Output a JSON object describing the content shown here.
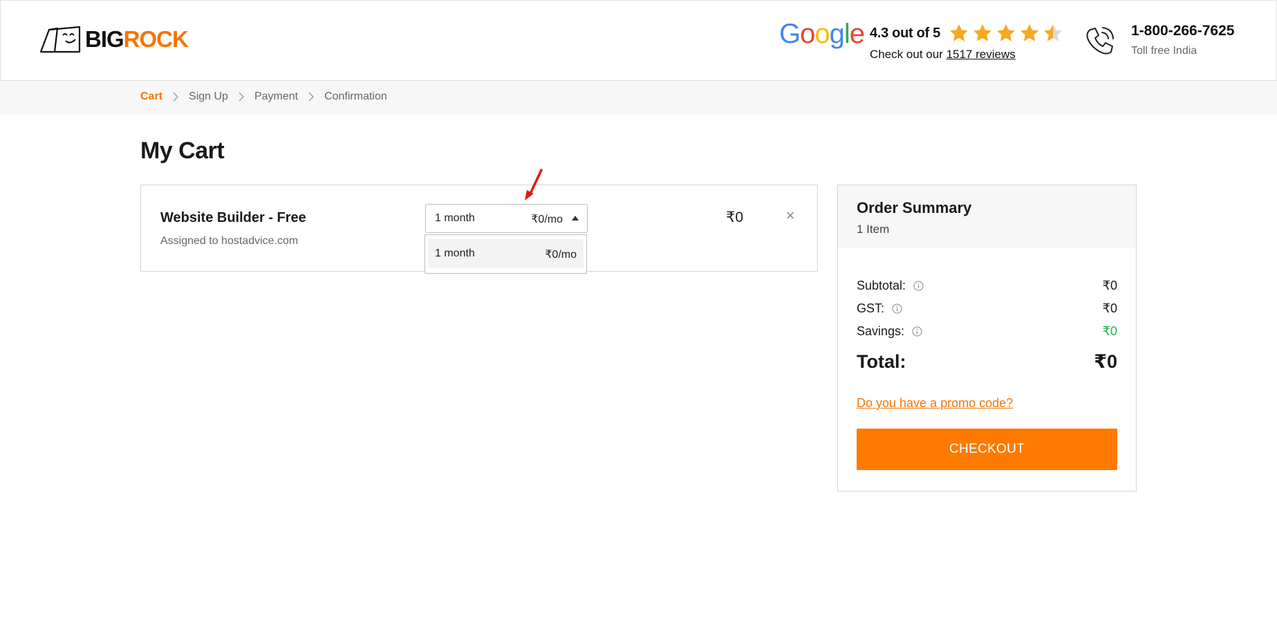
{
  "header": {
    "logo_big": "BIG",
    "logo_rock": "ROCK",
    "google_letters": [
      "G",
      "o",
      "o",
      "g",
      "l",
      "e"
    ],
    "rating_text": "4.3 out of 5",
    "stars": 4.5,
    "reviews_prefix": "Check out our ",
    "reviews_link": "1517 reviews",
    "phone_number": "1-800-266-7625",
    "phone_sub": "Toll free India"
  },
  "breadcrumb": {
    "items": [
      {
        "label": "Cart",
        "active": true
      },
      {
        "label": "Sign Up",
        "active": false
      },
      {
        "label": "Payment",
        "active": false
      },
      {
        "label": "Confirmation",
        "active": false
      }
    ]
  },
  "page_title": "My Cart",
  "cart_item": {
    "name": "Website Builder - Free",
    "assigned": "Assigned to hostadvice.com",
    "select_term": "1 month",
    "select_price": "₹0/mo",
    "price": "₹0",
    "remove_symbol": "×",
    "dropdown_options": [
      {
        "term": "1 month",
        "price": "₹0/mo"
      }
    ]
  },
  "summary": {
    "title": "Order Summary",
    "count": "1 Item",
    "subtotal_label": "Subtotal:",
    "subtotal_value": "₹0",
    "gst_label": "GST:",
    "gst_value": "₹0",
    "savings_label": "Savings:",
    "savings_value": "₹0",
    "total_label": "Total:",
    "total_value": "₹0",
    "promo": "Do you have a promo code?",
    "checkout": "CHECKOUT"
  },
  "colors": {
    "accent": "#f97300",
    "checkout_bg": "#ff7a00",
    "savings": "#22b14c",
    "annotation": "#e8190f"
  },
  "icons": {
    "logo": "bigrock-logo-icon",
    "phone": "phone-icon",
    "info": "info-icon",
    "remove": "close-icon",
    "caret": "caret-up-icon",
    "star": "star-icon",
    "annotation": "red-arrow-annotation"
  }
}
